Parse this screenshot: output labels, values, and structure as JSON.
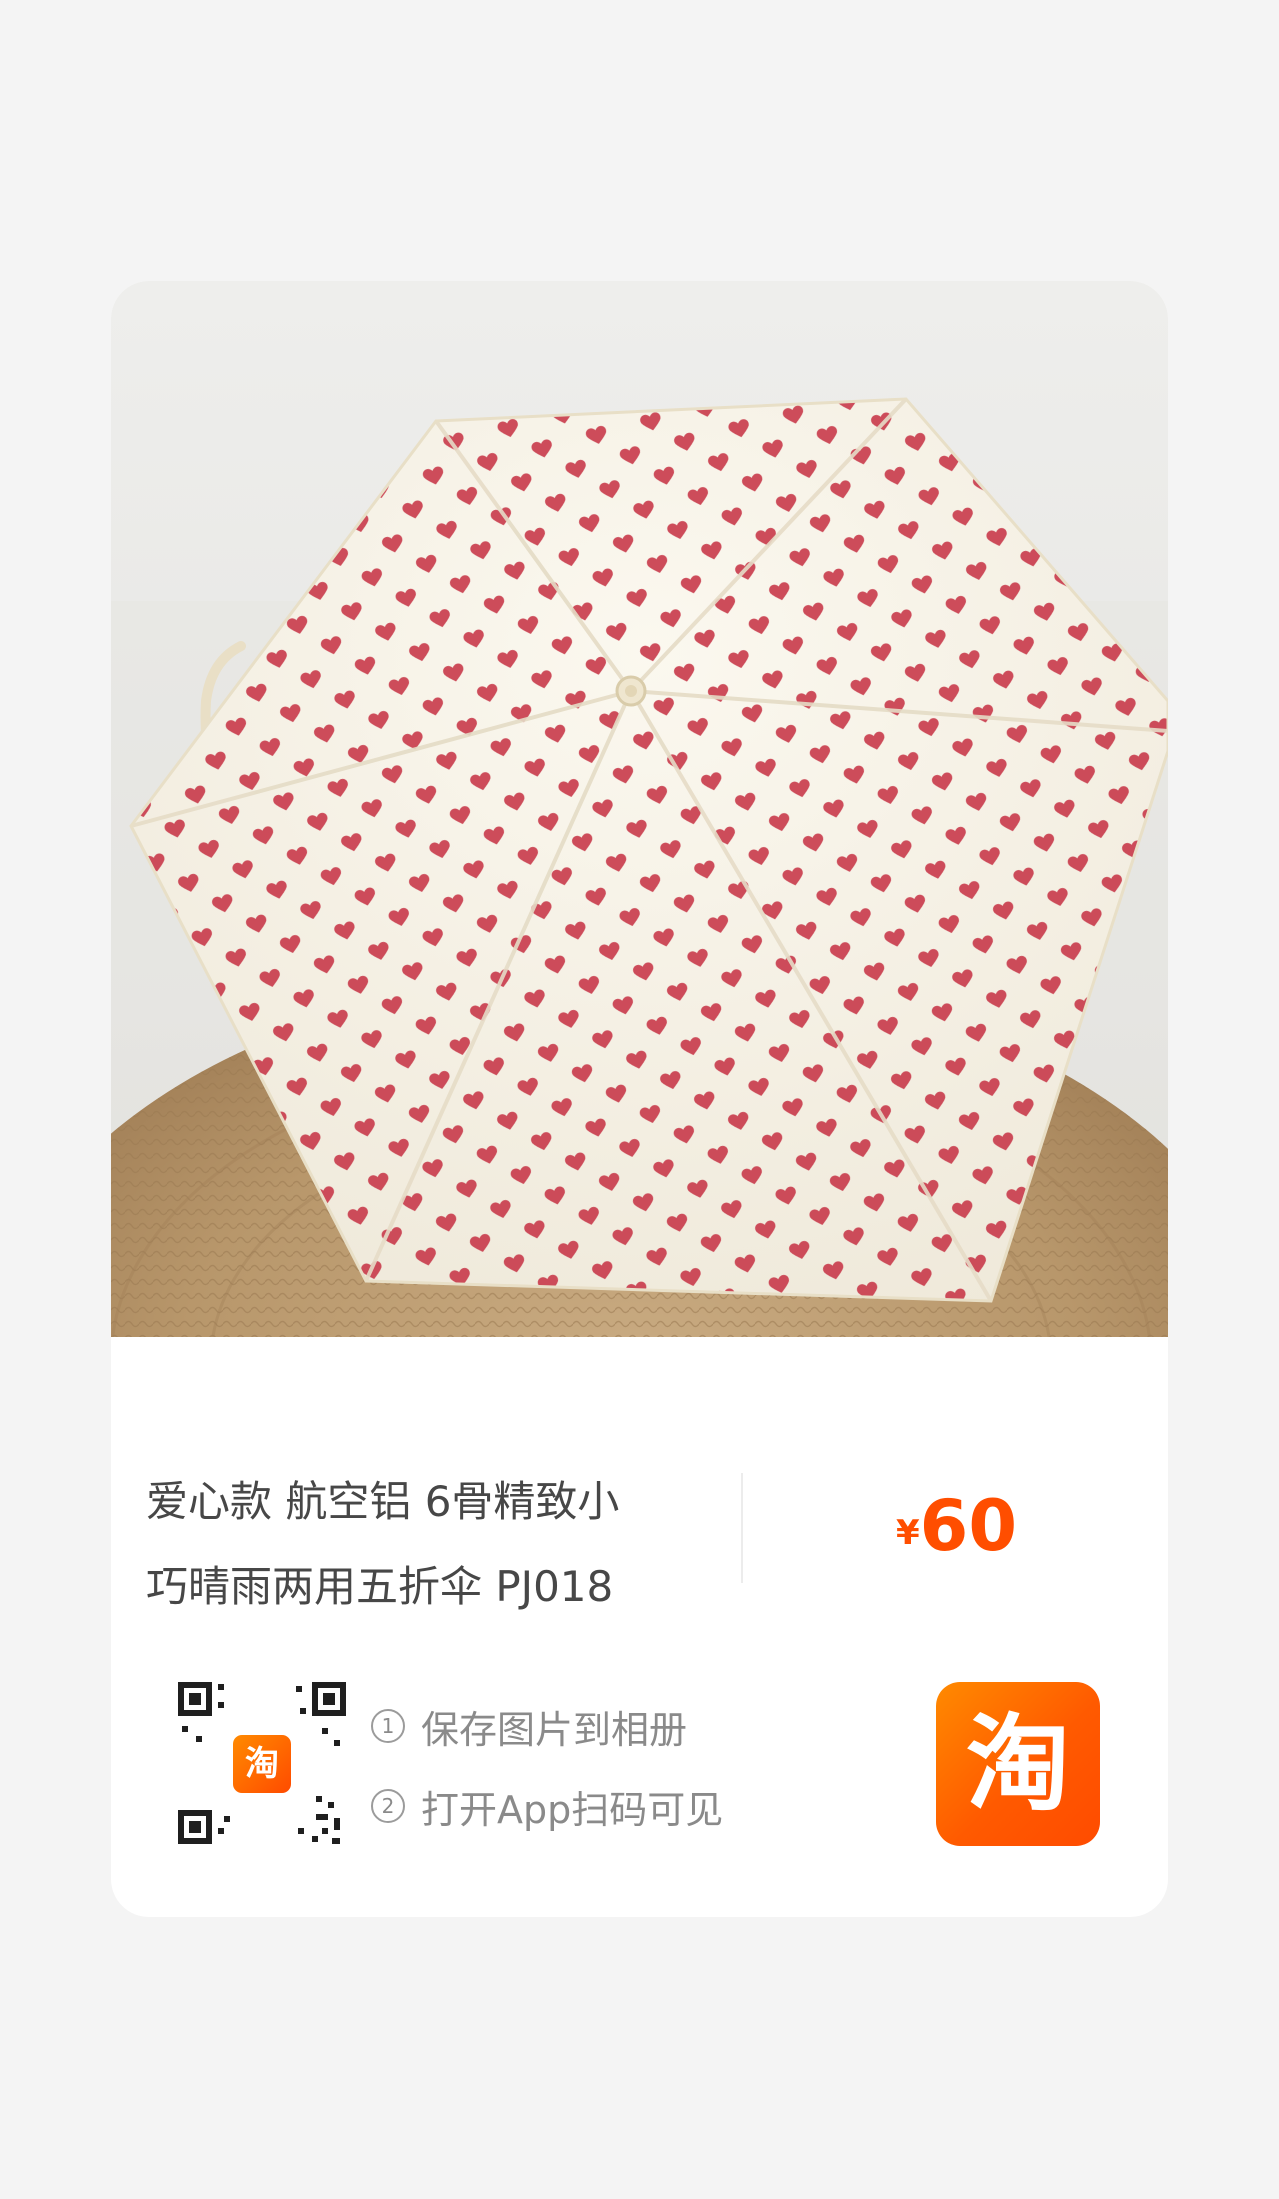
{
  "product": {
    "title": "爱心款 航空铝 6骨精致小\n巧晴雨两用五折伞 PJ018",
    "price_symbol": "¥",
    "price": "60"
  },
  "share": {
    "steps": [
      {
        "num": "1",
        "text": "保存图片到相册"
      },
      {
        "num": "2",
        "text": "打开App扫码可见"
      }
    ],
    "qr_logo": "淘",
    "badge_label": "淘",
    "badge_icon": "taobao-icon"
  },
  "colors": {
    "accent": "#ff5000",
    "price": "#ff4e00",
    "heart": "#c8394a",
    "card_bg": "#ffffff",
    "page_bg": "#f4f4f4"
  }
}
